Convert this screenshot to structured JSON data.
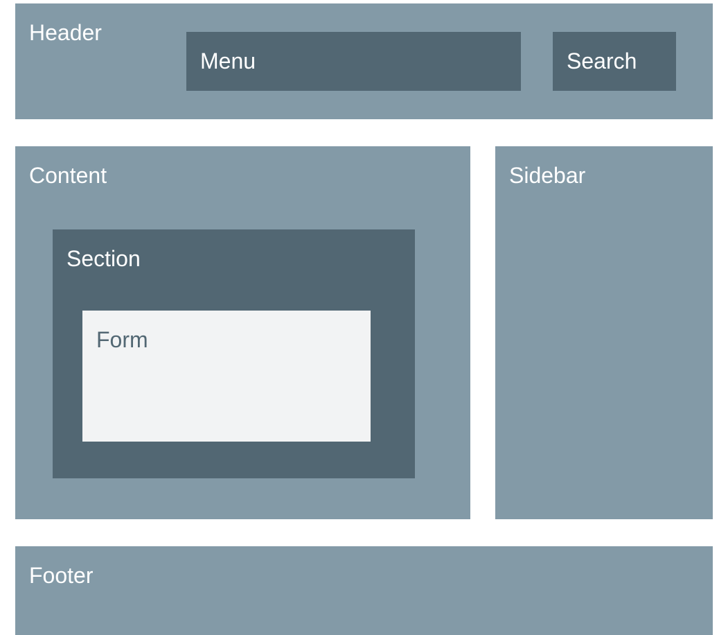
{
  "colors": {
    "region": "#839aa7",
    "inner": "#526773",
    "light": "#f2f3f4",
    "background": "#ffffff"
  },
  "header": {
    "label": "Header"
  },
  "menu": {
    "label": "Menu"
  },
  "search": {
    "label": "Search"
  },
  "content": {
    "label": "Content"
  },
  "section": {
    "label": "Section"
  },
  "form": {
    "label": "Form"
  },
  "sidebar": {
    "label": "Sidebar"
  },
  "footer": {
    "label": "Footer"
  }
}
